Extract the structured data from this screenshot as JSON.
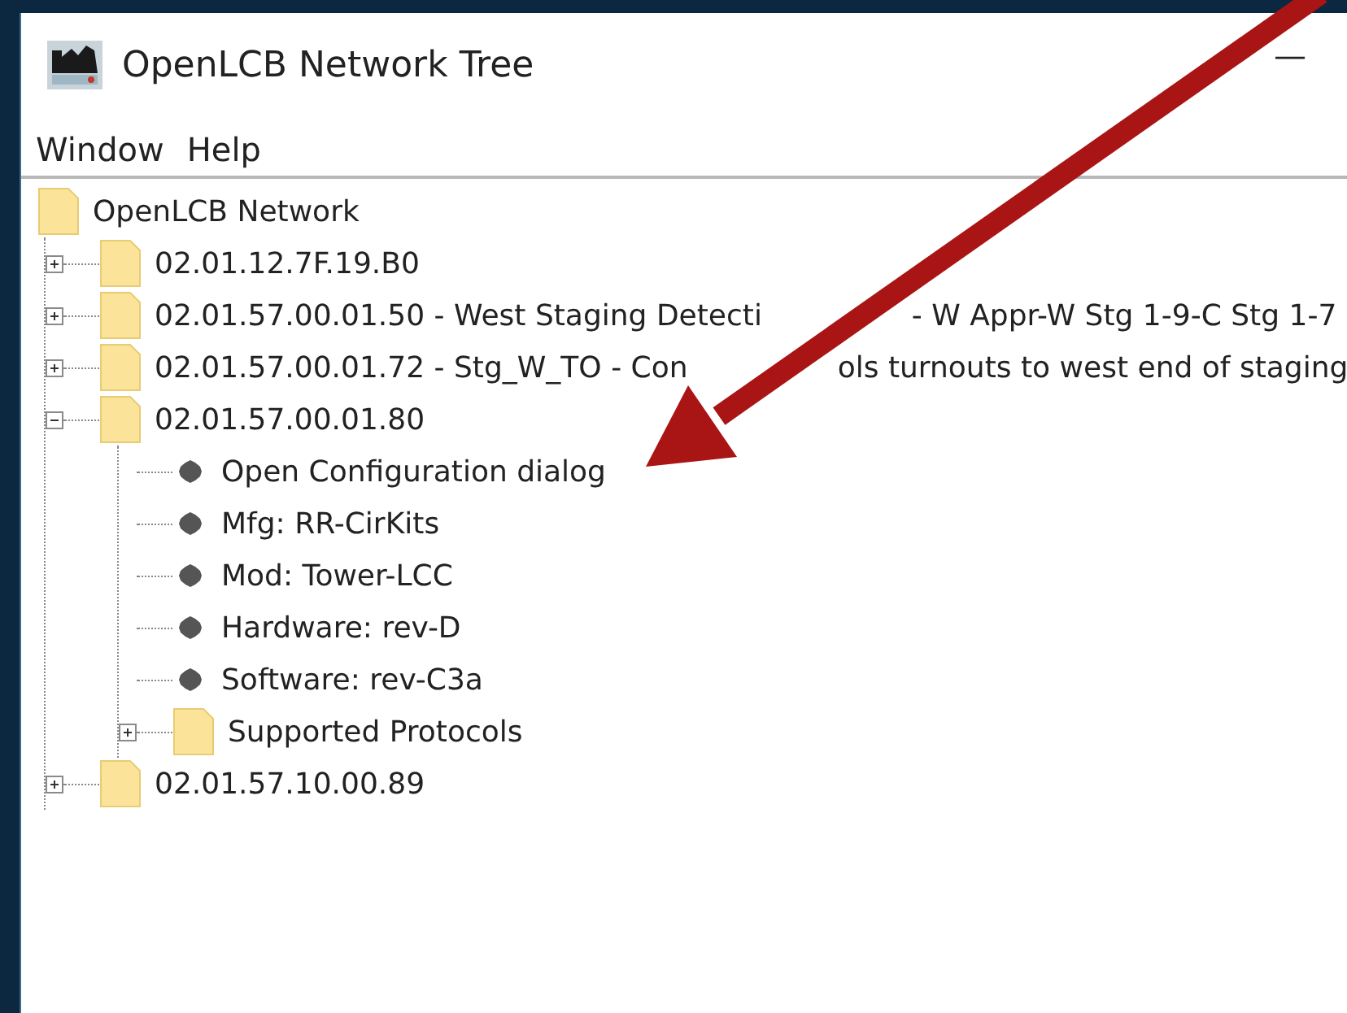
{
  "window": {
    "title": "OpenLCB Network Tree",
    "minimize": "—"
  },
  "menu": [
    {
      "label": "Window"
    },
    {
      "label": "Help"
    }
  ],
  "tree": {
    "label_parts": [
      "OpenLCB Network"
    ],
    "kind": "folder",
    "children": [
      {
        "label_parts": [
          "02.01.12.7F.19.B0"
        ],
        "kind": "folder",
        "expanded": false
      },
      {
        "label_parts": [
          "02.01.57.00.01.50 - West Staging Detecti",
          "- W Appr-W Stg 1-9-C Stg 1-7"
        ],
        "kind": "folder",
        "expanded": false
      },
      {
        "label_parts": [
          "02.01.57.00.01.72 - Stg_W_TO - Con",
          "ols turnouts to west end of staging"
        ],
        "kind": "folder",
        "expanded": false
      },
      {
        "label_parts": [
          "02.01.57.00.01.80"
        ],
        "kind": "folder",
        "expanded": true,
        "children": [
          {
            "label_parts": [
              "Open Configuration dialog"
            ],
            "kind": "leaf"
          },
          {
            "label_parts": [
              "Mfg: RR-CirKits"
            ],
            "kind": "leaf"
          },
          {
            "label_parts": [
              "Mod: Tower-LCC"
            ],
            "kind": "leaf"
          },
          {
            "label_parts": [
              "Hardware: rev-D"
            ],
            "kind": "leaf"
          },
          {
            "label_parts": [
              "Software: rev-C3a"
            ],
            "kind": "leaf"
          },
          {
            "label_parts": [
              "Supported Protocols"
            ],
            "kind": "folder",
            "expanded": false
          }
        ]
      },
      {
        "label_parts": [
          "02.01.57.10.00.89"
        ],
        "kind": "folder",
        "expanded": false
      }
    ]
  }
}
